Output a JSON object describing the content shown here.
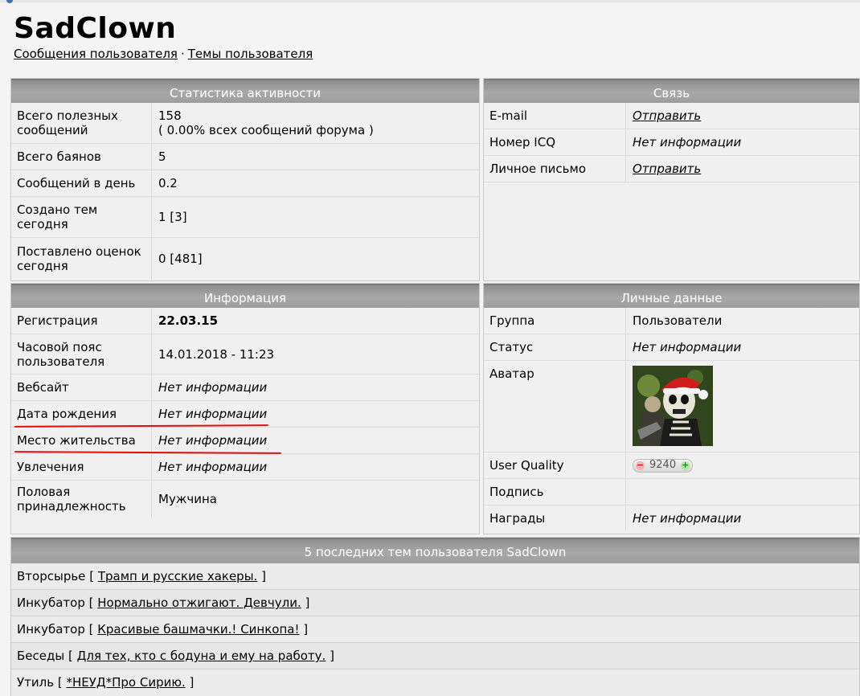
{
  "profile": {
    "username": "SadClown",
    "links": [
      "Сообщения пользователя",
      "Темы пользователя"
    ],
    "separator": "·"
  },
  "activity": {
    "title": "Статистика активности",
    "rows": [
      {
        "label": "Всего полезных сообщений",
        "value": "158",
        "sub": "( 0.00% всех сообщений форума )"
      },
      {
        "label": "Всего баянов",
        "value": "5"
      },
      {
        "label": "Сообщений в день",
        "value": "0.2"
      },
      {
        "label": "Создано тем сегодня",
        "value": "1 [3]"
      },
      {
        "label": "Поставлено оценок сегодня",
        "value": "0 [481]"
      }
    ]
  },
  "contact": {
    "title": "Связь",
    "rows": [
      {
        "label": "E-mail",
        "value": "Отправить"
      },
      {
        "label": "Номер ICQ",
        "value": "Нет информации"
      },
      {
        "label": "Личное письмо",
        "value": "Отправить"
      }
    ]
  },
  "info": {
    "title": "Информация",
    "rows": [
      {
        "label": "Регистрация",
        "value": "22.03.15"
      },
      {
        "label": "Часовой пояс пользователя",
        "value": "14.01.2018 - 11:23"
      },
      {
        "label": "Вебсайт",
        "value": "Нет информации"
      },
      {
        "label": "Дата рождения",
        "value": "Нет информации"
      },
      {
        "label": "Место жительства",
        "value": "Нет информации"
      },
      {
        "label": "Увлечения",
        "value": "Нет информации"
      },
      {
        "label": "Половая принадлежность",
        "value": "Мужчина"
      }
    ]
  },
  "personal": {
    "title": "Личные данные",
    "rows": [
      {
        "label": "Группа",
        "value": "Пользователи"
      },
      {
        "label": "Статус",
        "value": "Нет информации"
      },
      {
        "label": "Аватар",
        "value": ""
      },
      {
        "label": "User Quality",
        "value": "9240",
        "minus": "−",
        "plus": "+"
      },
      {
        "label": "Подпись",
        "value": ""
      },
      {
        "label": "Награды",
        "value": "Нет информации"
      }
    ]
  },
  "recent": {
    "title": "5 последних тем пользователя SadClown",
    "items": [
      {
        "section": "Вторсырье",
        "topic": "Трамп и русские хакеры."
      },
      {
        "section": "Инкубатор",
        "topic": "Нормально отжигают. Девчули."
      },
      {
        "section": "Инкубатор",
        "topic": "Красивые башмачки.! Синкопа!"
      },
      {
        "section": "Беседы",
        "topic": "Для тех, кто с бодуна и ему на работу."
      },
      {
        "section": "Утиль",
        "topic": "*НЕУД*Про Сирию."
      }
    ],
    "open_bracket": "[",
    "close_bracket": "]"
  },
  "colors": {
    "header_bg": "#9d9d9d",
    "panel_bg": "#f0f0f0",
    "annotation_red": "#e01010"
  }
}
